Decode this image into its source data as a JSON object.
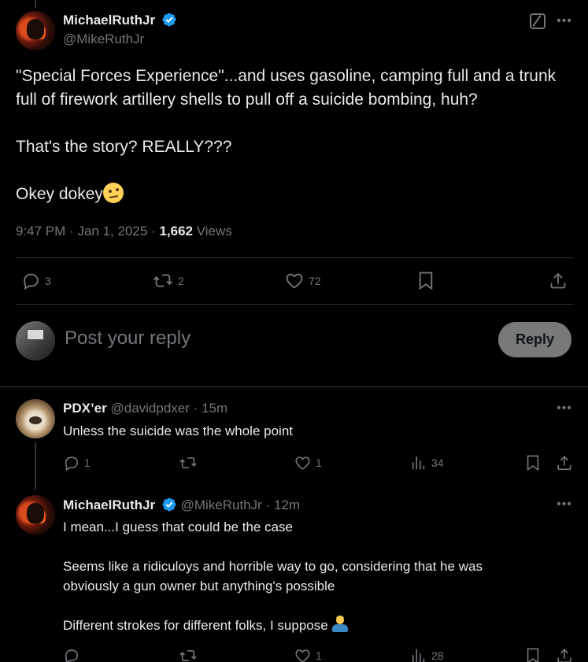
{
  "main_post": {
    "author_name": "MichaelRuthJr",
    "author_handle": "@MikeRuthJr",
    "text_line1": "\"Special Forces Experience\"...and uses gasoline, camping full and a trunk",
    "text_line2": "full of firework artillery shells to pull off a suicide bombing, huh?",
    "text_line3": "That's the story? REALLY???",
    "text_line4": "Okey dokey",
    "time": "9:47 PM",
    "date": "Jan 1, 2025",
    "views_count": "1,662",
    "views_label": "Views",
    "replies": "3",
    "reposts": "2",
    "likes": "72"
  },
  "reply_composer": {
    "placeholder": "Post your reply",
    "button_label": "Reply"
  },
  "replies": [
    {
      "author_name": "PDX’er",
      "author_handle": "@davidpdxer",
      "time_ago": "15m",
      "text": "Unless the suicide was the whole point",
      "replies": "1",
      "reposts": "",
      "likes": "1",
      "views": "34"
    },
    {
      "author_name": "MichaelRuthJr",
      "author_handle": "@MikeRuthJr",
      "time_ago": "12m",
      "text_line1": "I mean...I guess that could be the case",
      "text_line2": "Seems like a ridiculoys and horrible way to go, considering that he was",
      "text_line3": "obviously a gun owner but anything's possible",
      "text_line4": "Different strokes for different folks, I suppose",
      "replies": "",
      "reposts": "",
      "likes": "1",
      "views": "28"
    }
  ],
  "separators": {
    "dot": "·"
  },
  "colors": {
    "background": "#000000",
    "text": "#e7e9ea",
    "muted": "#71767b",
    "verified": "#1d9bf0",
    "reply_button": "#787a7a"
  }
}
